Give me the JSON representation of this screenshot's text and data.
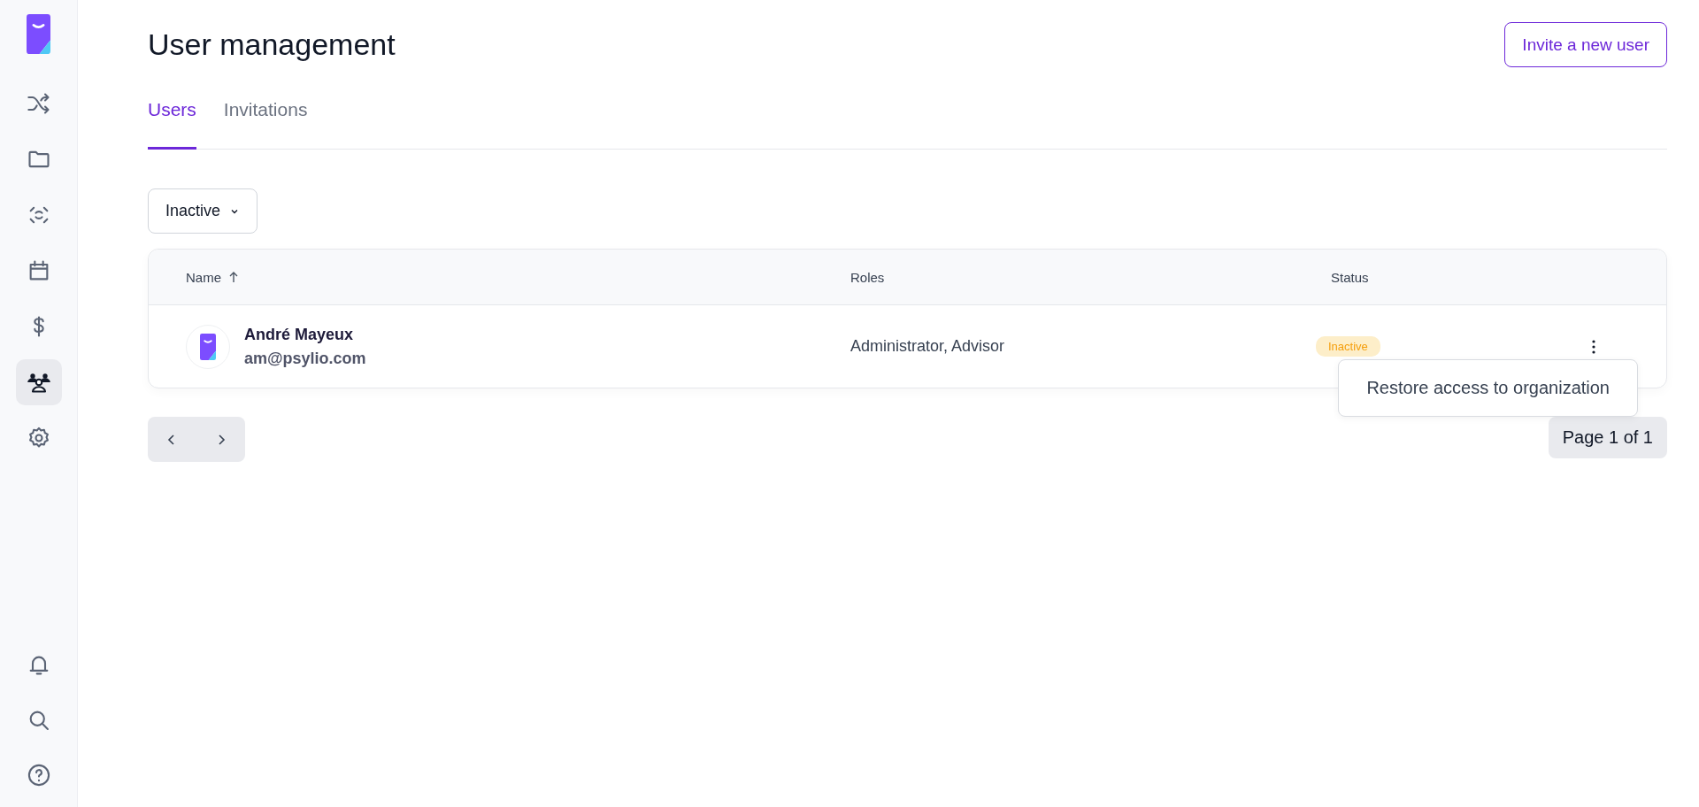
{
  "sidebar": {
    "nav_items": [
      {
        "selected": false
      },
      {
        "selected": false
      },
      {
        "selected": false
      },
      {
        "selected": false
      },
      {
        "selected": false
      },
      {
        "selected": true
      },
      {
        "selected": false
      }
    ],
    "bottom_items": [
      {
        "selected": false
      },
      {
        "selected": false
      },
      {
        "selected": false
      }
    ]
  },
  "header": {
    "title": "User management",
    "invite_button": "Invite a new user"
  },
  "tabs": [
    {
      "label": "Users",
      "selected": true
    },
    {
      "label": "Invitations",
      "selected": false
    }
  ],
  "filter": {
    "value": "Inactive"
  },
  "table": {
    "columns": [
      {
        "label": "Name",
        "sorted": true
      },
      {
        "label": "Roles",
        "sorted": false
      },
      {
        "label": "Status",
        "sorted": false
      }
    ],
    "rows": [
      {
        "name": "André Mayeux",
        "email": "am@psylio.com",
        "roles": "Administrator, Advisor",
        "status": "Inactive",
        "menu_open": true
      }
    ]
  },
  "row_menu": {
    "items": [
      "Restore access to organization"
    ]
  },
  "pagination": {
    "label": "Page 1 of 1"
  }
}
